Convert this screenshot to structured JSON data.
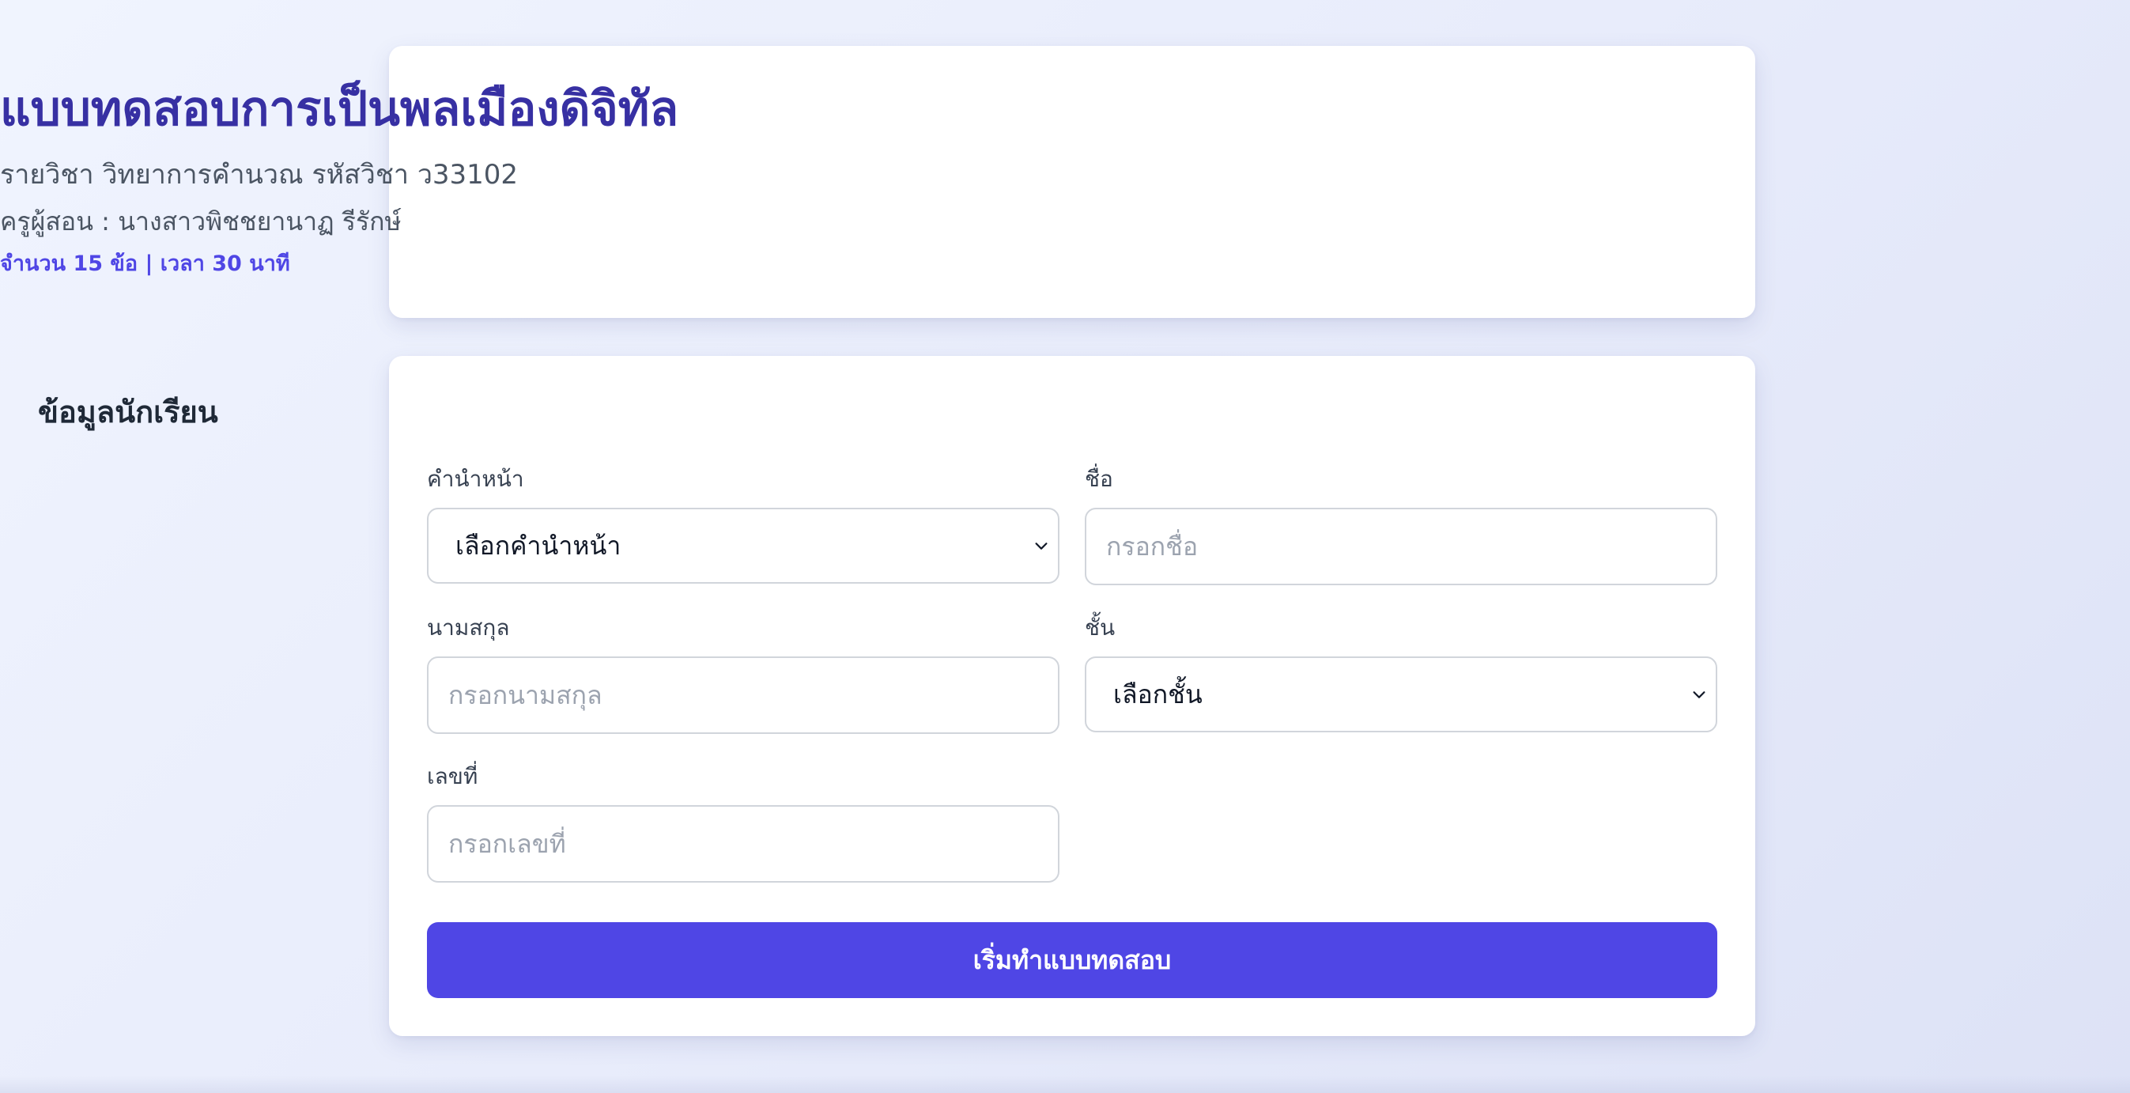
{
  "header": {
    "title": "แบบทดสอบการเป็นพลเมืองดิจิทัล",
    "subtitle": "รายวิชา วิทยาการคำนวณ รหัสวิชา ว33102",
    "teacher": "ครูผู้สอน : นางสาวพิชชยานาฏ รีรักษ์",
    "meta": "จำนวน 15 ข้อ | เวลา 30 นาที"
  },
  "form": {
    "section_title": "ข้อมูลนักเรียน",
    "prefix": {
      "label": "คำนำหน้า",
      "value": "เลือกคำนำหน้า"
    },
    "first_name": {
      "label": "ชื่อ",
      "placeholder": "กรอกชื่อ"
    },
    "last_name": {
      "label": "นามสกุล",
      "placeholder": "กรอกนามสกุล"
    },
    "grade": {
      "label": "ชั้น",
      "value": "เลือกชั้น"
    },
    "number": {
      "label": "เลขที่",
      "placeholder": "กรอกเลขที่"
    },
    "submit_label": "เริ่มทำแบบทดสอบ"
  },
  "colors": {
    "accent": "#4f46e5",
    "title": "#3730a3"
  }
}
